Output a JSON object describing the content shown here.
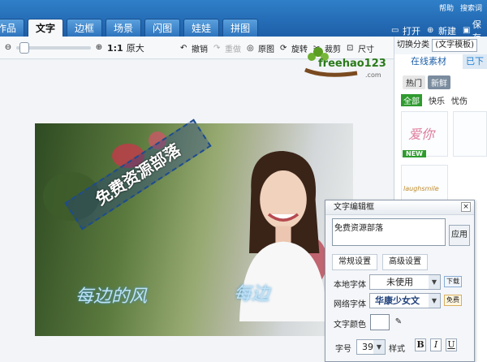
{
  "app": {
    "top_links": [
      "帮助",
      "搜索词"
    ],
    "tabs": [
      "作品",
      "文字",
      "边框",
      "场景",
      "闪图",
      "娃娃",
      "拼图"
    ],
    "active_tab": "文字",
    "actions": {
      "open": "打开",
      "new": "新建",
      "save": "保存"
    }
  },
  "toolbar": {
    "zoom_label": "1:1",
    "original_size": "原大",
    "undo": "撤销",
    "redo": "重做",
    "original": "原图",
    "rotate": "旋转",
    "crop": "裁剪",
    "size": "尺寸"
  },
  "canvas": {
    "logo_text": "freehao123",
    "logo_suffix": ".com",
    "stamp_text": "免费资源部落",
    "deco_left": "每边的风",
    "deco_right": "每边"
  },
  "right_panel": {
    "switch_label": "切换分类",
    "category": "(文字模板)",
    "tab_online": "在线素材",
    "tab_other": "已下",
    "filters": [
      "热门",
      "新鲜"
    ],
    "subfilters": [
      "全部",
      "快乐",
      "忧伤"
    ],
    "thumb_labels": [
      "爱你",
      "laughsmile"
    ],
    "new_badge": "NEW"
  },
  "dialog": {
    "title": "文字编辑框",
    "text_value": "免费资源部落",
    "apply": "应用",
    "tab_common": "常规设置",
    "tab_advanced": "高级设置",
    "local_font_label": "本地字体",
    "local_font_value": "未使用",
    "local_font_btn": "下载",
    "web_font_label": "网络字体",
    "web_font_value": "华康少女文",
    "web_font_btn": "免费",
    "color_label": "文字颜色",
    "size_label": "字号",
    "size_value": "39",
    "style_label": "样式",
    "bold": "B",
    "italic": "I",
    "underline": "U"
  },
  "colors": {
    "topbar": "#1d5fa8",
    "accent_green": "#2f9b2f",
    "stamp_blue": "#1d4c8f"
  }
}
